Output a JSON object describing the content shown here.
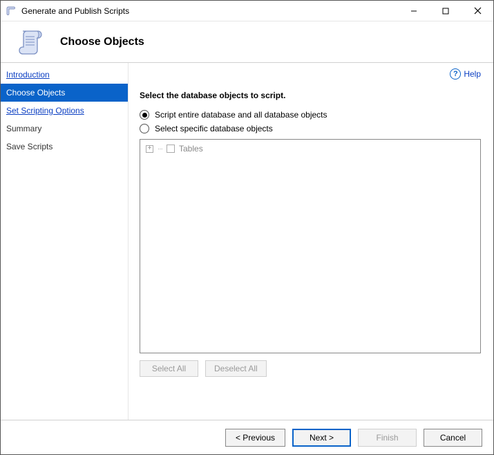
{
  "window": {
    "title": "Generate and Publish Scripts"
  },
  "header": {
    "page_title": "Choose Objects"
  },
  "help": {
    "label": "Help"
  },
  "sidebar": {
    "items": [
      {
        "label": "Introduction",
        "kind": "link",
        "selected": false
      },
      {
        "label": "Choose Objects",
        "kind": "selected",
        "selected": true
      },
      {
        "label": "Set Scripting Options",
        "kind": "link",
        "selected": false
      },
      {
        "label": "Summary",
        "kind": "plain",
        "selected": false
      },
      {
        "label": "Save Scripts",
        "kind": "plain",
        "selected": false
      }
    ]
  },
  "main": {
    "instruction": "Select the database objects to script.",
    "radio_all": "Script entire database and all database objects",
    "radio_specific": "Select specific database objects",
    "tree": {
      "root": "Tables"
    },
    "select_all": "Select All",
    "deselect_all": "Deselect All"
  },
  "footer": {
    "previous": "< Previous",
    "next": "Next >",
    "finish": "Finish",
    "cancel": "Cancel"
  }
}
